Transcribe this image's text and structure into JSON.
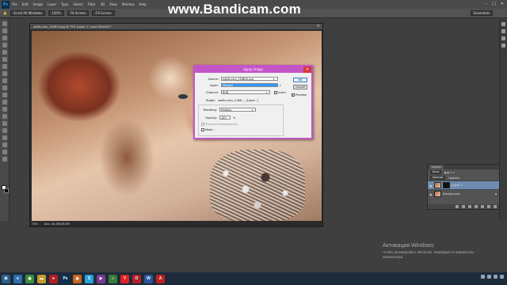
{
  "app": {
    "logo": "Ps",
    "menu": [
      "File",
      "Edit",
      "Image",
      "Layer",
      "Type",
      "Select",
      "Filter",
      "3D",
      "View",
      "Window",
      "Help"
    ]
  },
  "watermark": "www.Bandicam.com",
  "optbar": [
    "Scroll All Windows",
    "100%",
    "Fit Screen",
    "Fill Screen",
    "Essentials"
  ],
  "document": {
    "tab_title": "wallis.com_118810.jpg @ 75% (Layer 1, Layer Mask/8) *",
    "zoom": "75%",
    "doc_info": "Doc: 16,4M/16,6M"
  },
  "dialog": {
    "title": "Apply Image",
    "source_label": "Source:",
    "source_value": "wallis.com_118810.jpg",
    "layer_label": "Layer:",
    "layer_value": "Merged",
    "channel_label": "Channel:",
    "channel_value": "RGB",
    "invert_label": "Invert",
    "target_label": "Target:",
    "target_value": "wallis.com_1188..., (Layer...)",
    "blending_label": "Blending:",
    "blending_value": "Multiply",
    "opacity_label": "Opacity:",
    "opacity_value": "100",
    "opacity_unit": "%",
    "preserve_label": "Preserve Transparency",
    "mask_label": "Mask...",
    "ok_label": "OK",
    "cancel_label": "Cancel",
    "preview_label": "Preview",
    "preview_checked": true,
    "invert_checked": false
  },
  "layers_panel": {
    "tab": "Layers",
    "kind_label": "Kind",
    "blend_mode": "Normal",
    "opacity_label": "Opacity:",
    "fill_label": "Fill:",
    "layers": [
      {
        "name": "Layer 1",
        "active": true
      },
      {
        "name": "Background",
        "active": false
      }
    ]
  },
  "activation": {
    "title": "Активация Windows",
    "line1": "Чтобы активировать Windows, перейдите в параметры",
    "line2": "компьютера."
  },
  "taskbar": {
    "icons": [
      {
        "name": "start-icon",
        "color": "#2d5c8a",
        "glyph": "⊞"
      },
      {
        "name": "explorer-icon",
        "color": "#2f6fb0",
        "glyph": "e"
      },
      {
        "name": "chrome-icon",
        "color": "#3c8d3c",
        "glyph": "◉"
      },
      {
        "name": "folder-icon",
        "color": "#c49a2a",
        "glyph": "▬"
      },
      {
        "name": "record-icon",
        "color": "#b02020",
        "glyph": "●"
      },
      {
        "name": "photoshop-icon",
        "color": "#0b2f4e",
        "glyph": "Ps"
      },
      {
        "name": "firefox-icon",
        "color": "#c8641e",
        "glyph": "◍"
      },
      {
        "name": "skype-icon",
        "color": "#2aa1d8",
        "glyph": "S"
      },
      {
        "name": "media-icon",
        "color": "#7b3a8f",
        "glyph": "▶"
      },
      {
        "name": "music-icon",
        "color": "#3a7a3a",
        "glyph": "♫"
      },
      {
        "name": "yandex-icon",
        "color": "#d22",
        "glyph": "Y"
      },
      {
        "name": "opera-icon",
        "color": "#b01f2b",
        "glyph": "O"
      },
      {
        "name": "word-icon",
        "color": "#2a5699",
        "glyph": "W"
      },
      {
        "name": "pdf-icon",
        "color": "#c02020",
        "glyph": "A"
      }
    ]
  }
}
